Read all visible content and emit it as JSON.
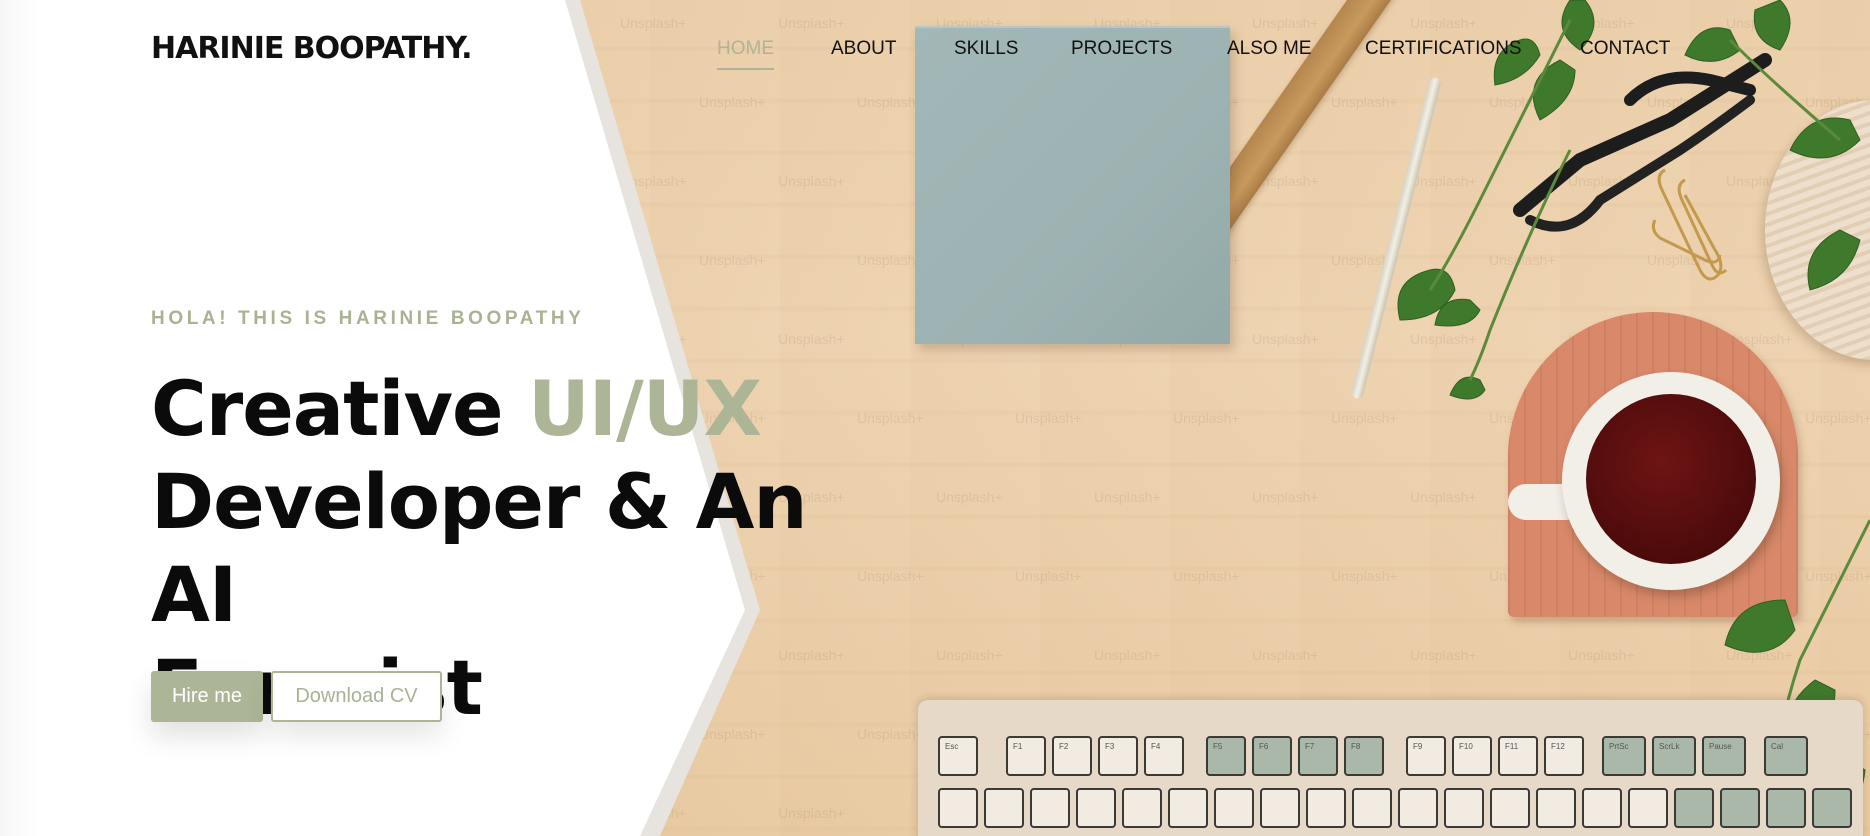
{
  "brand": {
    "logo_text": "HARINIE BOOPATHY."
  },
  "nav": {
    "items": [
      {
        "label": "HOME",
        "active": true
      },
      {
        "label": "ABOUT",
        "active": false
      },
      {
        "label": "SKILLS",
        "active": false
      },
      {
        "label": "PROJECTS",
        "active": false
      },
      {
        "label": "ALSO ME",
        "active": false
      },
      {
        "label": "CERTIFICATIONS",
        "active": false
      },
      {
        "label": "CONTACT",
        "active": false
      }
    ]
  },
  "hero": {
    "eyebrow": "HOLA! THIS IS HARINIE BOOPATHY",
    "title_part1": "Creative ",
    "title_accent": "UI/UX",
    "title_line2": "Developer & An AI",
    "title_line3": "Fururist",
    "hire_label": "Hire me",
    "cv_label": "Download CV"
  },
  "background": {
    "watermark_text": "Unsplash+",
    "keyboard_keys": [
      "Esc",
      "F1",
      "F2",
      "F3",
      "F4",
      "F5",
      "F6",
      "F7",
      "F8",
      "F9",
      "F10",
      "F11",
      "F12",
      "PrtSc",
      "ScrLk",
      "Pause",
      "Cal"
    ]
  },
  "colors": {
    "accent": "#adb597",
    "text": "#111111",
    "panel": "#ffffff",
    "desk": "#ecd0ac"
  }
}
